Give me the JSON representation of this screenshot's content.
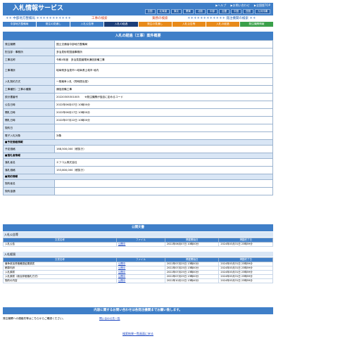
{
  "header": {
    "title": "入札情報サービス",
    "links": [
      "▶ヘルプ",
      "▶お問い合わせ",
      "▶全国版TOP"
    ],
    "regions": [
      "全国",
      "北海道",
      "東北",
      "関東",
      "北陸",
      "中部",
      "近畿",
      "中国",
      "四国",
      "九州沖縄"
    ]
  },
  "subnav": {
    "left": "＊＊ 中部地方整備局 ＊＊＊＊＊＊＊＊＊＊＊",
    "mid1": "工事の検索",
    "mid2": "業務の検索",
    "right": "＊＊＊＊＊＊＊＊＊＊＊＊ 発注機関の検索 ＊＊"
  },
  "tabs": [
    "中部地方整備局",
    "発注の見通し",
    "入札公告等",
    "入札の経過",
    "発注の見通し",
    "入札公告等",
    "入札の経過",
    "発注機関情報"
  ],
  "main_title": "入札の経過（工事）案件概要",
  "details": [
    {
      "label": "発注機関",
      "value": "国土交通省中部地方整備局"
    },
    {
      "label": "担当部・事務所",
      "value": "多治見砂防国道事務所"
    },
    {
      "label": "工事名称",
      "value": "令和4年度　多治見国道電気通信設備工事"
    },
    {
      "label": "工事場所",
      "value": "岐阜県多治見市～岐阜県土岐市 地内",
      "tall": true
    },
    {
      "label": "入札契約方式",
      "value": "一般競争入札（同時提出型）"
    },
    {
      "label": "工事種別／工事の種類",
      "value": "通信設備工事"
    },
    {
      "label": "設計書番号",
      "value": "20220305301005　　※発注機関が独自に定めるコード"
    },
    {
      "label": "公告日時",
      "value": "2022年06月07日 10時00分"
    },
    {
      "label": "開札日時",
      "value": "2022年06月17日 10時00分"
    },
    {
      "label": "開札日時",
      "value": "2022年07月22日 10時00分"
    },
    {
      "label": "契約日",
      "value": ""
    },
    {
      "label": "電子入札対象",
      "value": "対象"
    }
  ],
  "sections": {
    "estimate": {
      "title": "■予定価格情報",
      "label": "予定価格",
      "value": "168,500,000（税抜き）"
    },
    "winner": {
      "title": "■落札者情報",
      "name_label": "落札者名",
      "name": "エフコム株式会社",
      "amount_label": "落札価格",
      "amount": "153,800,000（税抜き）"
    },
    "contract": {
      "title": "■契約情報",
      "items": [
        {
          "label": "契約者名",
          "value": ""
        },
        {
          "label": "契約金額",
          "value": ""
        }
      ]
    }
  },
  "docs": {
    "title": "公開文書",
    "notice_label": "入札公告等",
    "col_headers": [
      "文書名称",
      "ファイル",
      "掲載開始日",
      "掲載終了日"
    ],
    "notice_rows": [
      {
        "name": "入札公告",
        "file": "公開中",
        "start": "2022年06月07日 10時00分",
        "end": "2024年03月31日 23時59分"
      }
    ],
    "process_label": "入札経過",
    "process_rows": [
      {
        "name": "競争参加資格確認結果調書",
        "file": "公開中",
        "start": "2022年07月25日 13時00分",
        "end": "2024年03月31日 23時59分"
      },
      {
        "name": "積算内訳",
        "file": "公開中",
        "start": "2022年07月25日 13時00分",
        "end": "2024年03月31日 23時59分"
      },
      {
        "name": "入札調書",
        "file": "公開中",
        "start": "2022年07月25日 13時00分",
        "end": "2024年03月31日 23時59分"
      },
      {
        "name": "入札調書（総合評価落札方式）",
        "file": "公開中",
        "start": "2022年07月25日 13時00分",
        "end": "2024年03月31日 23時59分"
      },
      {
        "name": "契約の内容",
        "file": "公開中",
        "start": "2022年10月12日 13時40分",
        "end": "2024年03月31日 23時59分"
      }
    ]
  },
  "contact": {
    "title": "内容に関するお問い合わせは各発注機関までお願い致します。",
    "label": "発注機関への連絡先等はこちらからご確認ください。",
    "link": "問い合わせ先一覧"
  },
  "back_link": "検索結果一覧画面に戻る"
}
